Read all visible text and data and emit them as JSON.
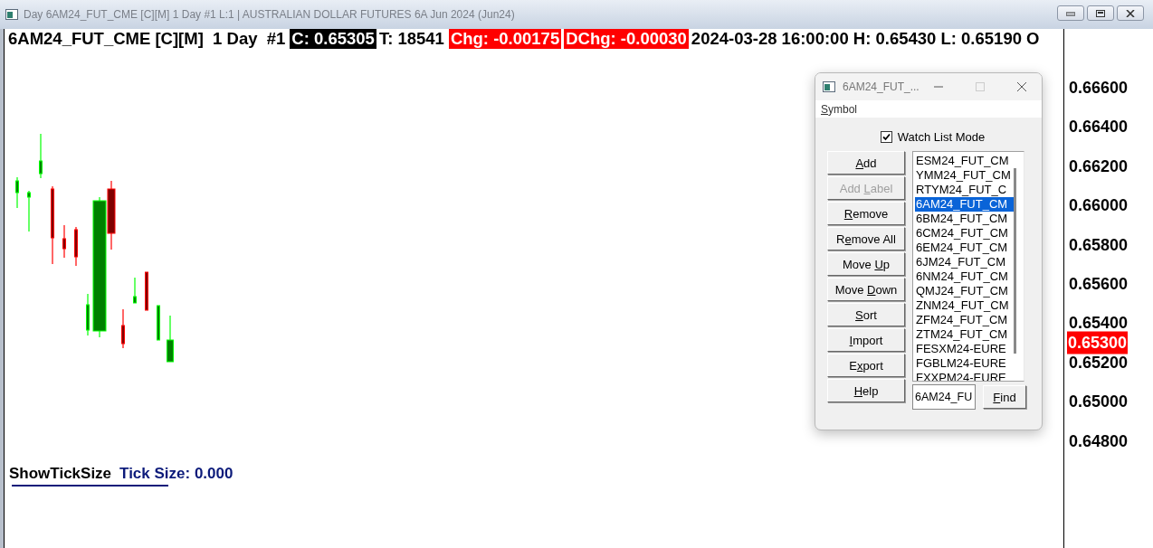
{
  "window": {
    "title": "Day 6AM24_FUT_CME [C][M]  1 Day  #1 L:1 | AUSTRALIAN DOLLAR FUTURES 6A Jun 2024 (Jun24)"
  },
  "header": [
    {
      "text": "6AM24_FUT_CME [C][M]  1 Day  #1",
      "kind": "plain"
    },
    {
      "text": "C: 0.65305",
      "kind": "inverse"
    },
    {
      "text": "T: 18541",
      "kind": "plain"
    },
    {
      "text": "Chg: -0.00175",
      "kind": "alert"
    },
    {
      "text": "DChg: -0.00030",
      "kind": "alert"
    },
    {
      "text": "2024-03-28 16:00:00 H: 0.65430 L: 0.65190 O",
      "kind": "plain"
    }
  ],
  "price_axis": {
    "labels": [
      "0.66600",
      "0.66400",
      "0.66200",
      "0.66000",
      "0.65800",
      "0.65600",
      "0.65400",
      "0.65200",
      "0.65000",
      "0.64800"
    ],
    "current": "0.65300"
  },
  "study": {
    "name": "ShowTickSize",
    "value": "Tick Size: 0.000"
  },
  "dialog": {
    "title": "6AM24_FUT_...",
    "menu": [
      {
        "key": "S",
        "post": "ymbol"
      }
    ],
    "watch_list_mode": {
      "label": "Watch List Mode",
      "checked": true
    },
    "buttons": [
      {
        "key": "A",
        "post": "dd",
        "disabled": false
      },
      {
        "pre": "Add ",
        "key": "L",
        "post": "abel",
        "disabled": true
      },
      {
        "key": "R",
        "post": "emove",
        "disabled": false
      },
      {
        "pre": "R",
        "key": "e",
        "post": "move All",
        "disabled": false
      },
      {
        "pre": "Move ",
        "key": "U",
        "post": "p",
        "disabled": false
      },
      {
        "pre": "Move ",
        "key": "D",
        "post": "own",
        "disabled": false
      },
      {
        "key": "S",
        "post": "ort",
        "disabled": false
      },
      {
        "key": "I",
        "post": "mport",
        "disabled": false
      },
      {
        "pre": "E",
        "key": "x",
        "post": "port",
        "disabled": false
      },
      {
        "key": "H",
        "post": "elp",
        "disabled": false
      }
    ],
    "symbols": [
      {
        "text": "ESM24_FUT_CM",
        "selected": false
      },
      {
        "text": "YMM24_FUT_CM",
        "selected": false
      },
      {
        "text": "RTYM24_FUT_C",
        "selected": false
      },
      {
        "text": "6AM24_FUT_CM",
        "selected": true
      },
      {
        "text": "6BM24_FUT_CM",
        "selected": false
      },
      {
        "text": "6CM24_FUT_CM",
        "selected": false
      },
      {
        "text": "6EM24_FUT_CM",
        "selected": false
      },
      {
        "text": "6JM24_FUT_CM",
        "selected": false
      },
      {
        "text": "6NM24_FUT_CM",
        "selected": false
      },
      {
        "text": "QMJ24_FUT_CM",
        "selected": false
      },
      {
        "text": "ZNM24_FUT_CM",
        "selected": false
      },
      {
        "text": "ZFM24_FUT_CM",
        "selected": false
      },
      {
        "text": "ZTM24_FUT_CM",
        "selected": false
      },
      {
        "text": "FESXM24-EURE",
        "selected": false
      },
      {
        "text": "FGBLM24-EURE",
        "selected": false
      },
      {
        "text": "FXXPM24-EURE",
        "selected": false
      }
    ],
    "find_value": "6AM24_FU",
    "find_button": {
      "key": "F",
      "post": "ind"
    }
  }
}
